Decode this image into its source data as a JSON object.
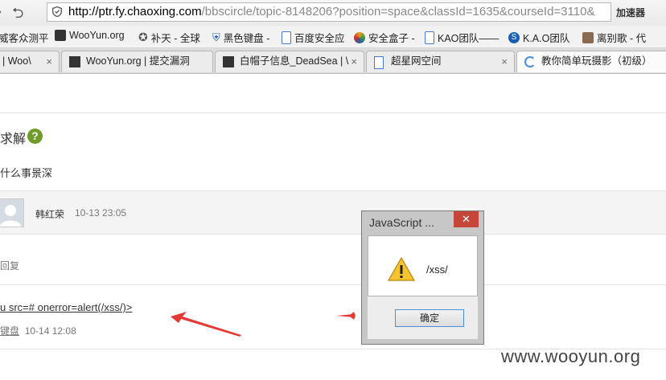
{
  "browser": {
    "back_symbol": "⮌",
    "url_host": "http://ptr.fy.chaoxing.com",
    "url_rest": "/bbscircle/topic-8148206?position=space&classId=1635&courseId=3110&",
    "accelerator_label": "加速器"
  },
  "bookmarks": [
    {
      "label": "威客众测平",
      "icon": "bookmark-icon",
      "color": "#e07020"
    },
    {
      "label": "WooYun.org",
      "icon": "wooyun-icon",
      "color": "#333333"
    },
    {
      "label": "补天 - 全球",
      "icon": "star-icon",
      "color": "#555555"
    },
    {
      "label": "黑色键盘 -",
      "icon": "shield-icon",
      "color": "#2a5ca8"
    },
    {
      "label": "百度安全应",
      "icon": "page-icon",
      "color": "#4a7ad0"
    },
    {
      "label": "安全盒子 -",
      "icon": "colorful-icon",
      "color": "#e0a020"
    },
    {
      "label": "KAO团队——",
      "icon": "page-icon",
      "color": "#4a7ad0"
    },
    {
      "label": "K.A.O团队",
      "icon": "s-icon",
      "color": "#1a5fb4"
    },
    {
      "label": "离别歌 - 代",
      "icon": "avatar-icon",
      "color": "#8a6a50"
    }
  ],
  "tabs": [
    {
      "label": "| Woo\\",
      "icon": "",
      "active": false
    },
    {
      "label": "WooYun.org | 提交漏洞",
      "icon": "wooyun-icon",
      "active": false
    },
    {
      "label": "白帽子信息_DeadSea | \\",
      "icon": "wooyun-icon",
      "active": false
    },
    {
      "label": "超星网空间",
      "icon": "page-icon",
      "active": false
    },
    {
      "label": "教你简单玩摄影（初级）",
      "icon": "loading-icon",
      "active": true
    }
  ],
  "tab_close": "×",
  "page": {
    "title": "求解",
    "help_symbol": "?",
    "subtitle": "什么事景深",
    "reply_user": "韩红荣",
    "reply_time": "10-13 23:05",
    "reply_label": "回复",
    "xss_text": "u src=# onerror=alert(/xss/)>",
    "meta_user": "键盘",
    "meta_time": "10-14 12:08"
  },
  "dialog": {
    "title": "JavaScript ...",
    "close_symbol": "✕",
    "message": "/xss/",
    "ok_label": "确定"
  },
  "watermark": "www.wooyun.org",
  "colors": {
    "accent_red": "#e53935",
    "help_green": "#6e9c2b",
    "dialog_close": "#c7463b"
  }
}
